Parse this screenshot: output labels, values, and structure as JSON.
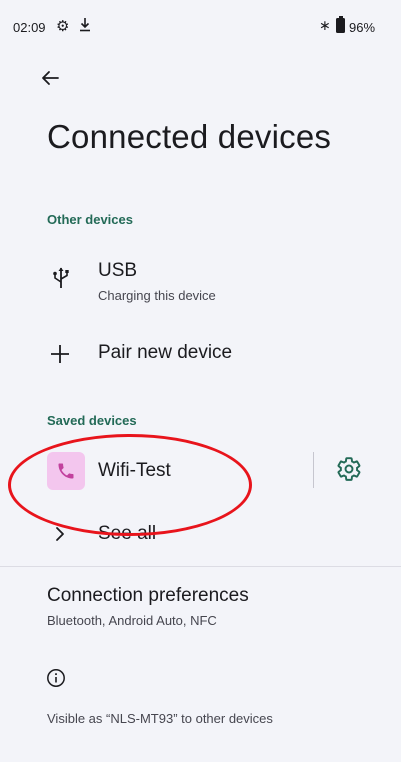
{
  "status_bar": {
    "time": "02:09",
    "battery_pct": "96%",
    "icons": [
      "gear-icon",
      "download-icon",
      "bluetooth-icon",
      "battery-icon"
    ]
  },
  "title": "Connected devices",
  "other_devices": {
    "header": "Other devices",
    "items": [
      {
        "title": "USB",
        "subtitle": "Charging this device",
        "icon": "usb-icon"
      },
      {
        "title": "Pair new device",
        "icon": "plus-icon"
      }
    ]
  },
  "saved_devices": {
    "header": "Saved devices",
    "device": {
      "name": "Wifi-Test",
      "icon": "phone-icon",
      "settings_icon": "gear-icon"
    },
    "see_all": "See all"
  },
  "preferences": {
    "title": "Connection preferences",
    "subtitle": "Bluetooth, Android Auto, NFC"
  },
  "footer": {
    "info_icon": "info-icon",
    "visible_text": "Visible as “NLS-MT93” to other devices"
  },
  "colors": {
    "accent": "#236a57",
    "background": "#f3f4f9",
    "badge": "#f3c6ee",
    "phone_icon": "#c2419e",
    "annotation": "#e8141c"
  }
}
